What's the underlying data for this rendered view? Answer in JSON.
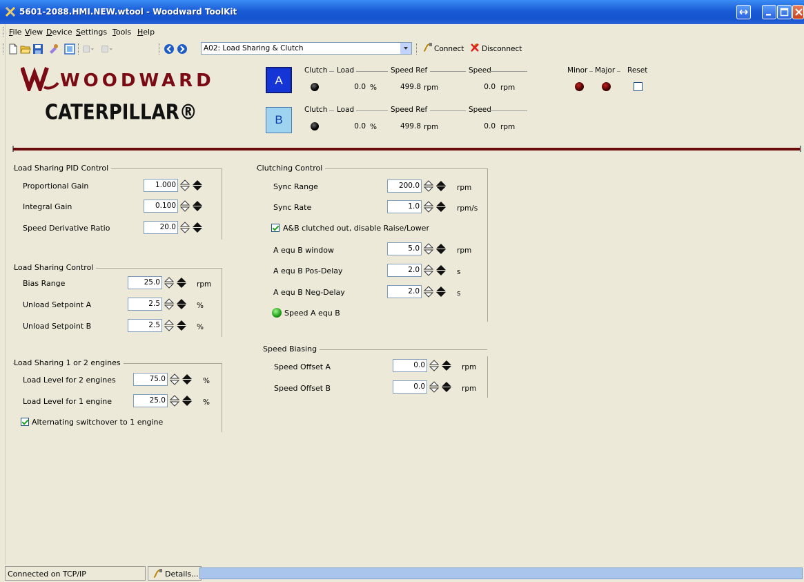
{
  "window": {
    "title": "5601-2088.HMI.NEW.wtool - Woodward ToolKit",
    "colors": {
      "titlebar": "#1a5bd6",
      "background": "#ece9d8",
      "divider": "#6b0c0c"
    }
  },
  "menu": {
    "items": [
      {
        "label": "File",
        "accel": "F"
      },
      {
        "label": "View",
        "accel": "V"
      },
      {
        "label": "Device",
        "accel": "D"
      },
      {
        "label": "Settings",
        "accel": "S"
      },
      {
        "label": "Tools",
        "accel": "T"
      },
      {
        "label": "Help",
        "accel": "H"
      }
    ]
  },
  "toolbar": {
    "page_select": "A02: Load Sharing & Clutch",
    "connect_label": "Connect",
    "disconnect_label": "Disconnect"
  },
  "logos": {
    "woodward": "WOODWARD",
    "caterpillar": "CATERPILLAR®"
  },
  "engines": {
    "headers": {
      "clutch": "Clutch",
      "load": "Load",
      "speed_ref": "Speed Ref",
      "speed": "Speed"
    },
    "a": {
      "label": "A",
      "load": "0.0",
      "load_unit": "%",
      "speed_ref": "499.8",
      "speed_ref_unit": "rpm",
      "speed": "0.0",
      "speed_unit": "rpm",
      "clutch_led": "black"
    },
    "b": {
      "label": "B",
      "load": "0.0",
      "load_unit": "%",
      "speed_ref": "499.8",
      "speed_ref_unit": "rpm",
      "speed": "0.0",
      "speed_unit": "rpm",
      "clutch_led": "black"
    }
  },
  "alarms": {
    "minor": "Minor",
    "major": "Major",
    "reset": "Reset",
    "minor_led": "dark-red",
    "major_led": "dark-red",
    "reset_checked": false
  },
  "pid": {
    "title": "Load Sharing PID Control",
    "prop_gain": {
      "label": "Proportional Gain",
      "value": "1.000"
    },
    "int_gain": {
      "label": "Integral Gain",
      "value": "0.100"
    },
    "sdr": {
      "label": "Speed Derivative Ratio",
      "value": "20.0"
    }
  },
  "lsc": {
    "title": "Load Sharing Control",
    "bias_range": {
      "label": "Bias Range",
      "value": "25.0",
      "unit": "rpm"
    },
    "unload_a": {
      "label": "Unload Setpoint A",
      "value": "2.5",
      "unit": "%"
    },
    "unload_b": {
      "label": "Unload Setpoint B",
      "value": "2.5",
      "unit": "%"
    }
  },
  "ls12": {
    "title": "Load Sharing 1 or 2 engines",
    "lvl2": {
      "label": "Load Level for 2 engines",
      "value": "75.0",
      "unit": "%"
    },
    "lvl1": {
      "label": "Load Level for 1 engine",
      "value": "25.0",
      "unit": "%"
    },
    "alt": {
      "label": "Alternating switchover to 1 engine",
      "checked": true
    }
  },
  "clutch": {
    "title": "Clutching Control",
    "sync_range": {
      "label": "Sync Range",
      "value": "200.0",
      "unit": "rpm"
    },
    "sync_rate": {
      "label": "Sync Rate",
      "value": "1.0",
      "unit": "rpm/s"
    },
    "clutched_out": {
      "label": "A&B clutched out, disable Raise/Lower",
      "checked": true
    },
    "window": {
      "label": "A equ B window",
      "value": "5.0",
      "unit": "rpm"
    },
    "pos_delay": {
      "label": "A equ B Pos-Delay",
      "value": "2.0",
      "unit": "s"
    },
    "neg_delay": {
      "label": "A equ B Neg-Delay",
      "value": "2.0",
      "unit": "s"
    },
    "speed_equ": {
      "label": "Speed A equ B",
      "led": "green"
    }
  },
  "bias": {
    "title": "Speed Biasing",
    "offset_a": {
      "label": "Speed Offset A",
      "value": "0.0",
      "unit": "rpm"
    },
    "offset_b": {
      "label": "Speed Offset B",
      "value": "0.0",
      "unit": "rpm"
    }
  },
  "status": {
    "connection": "Connected on TCP/IP",
    "details": "Details..."
  }
}
